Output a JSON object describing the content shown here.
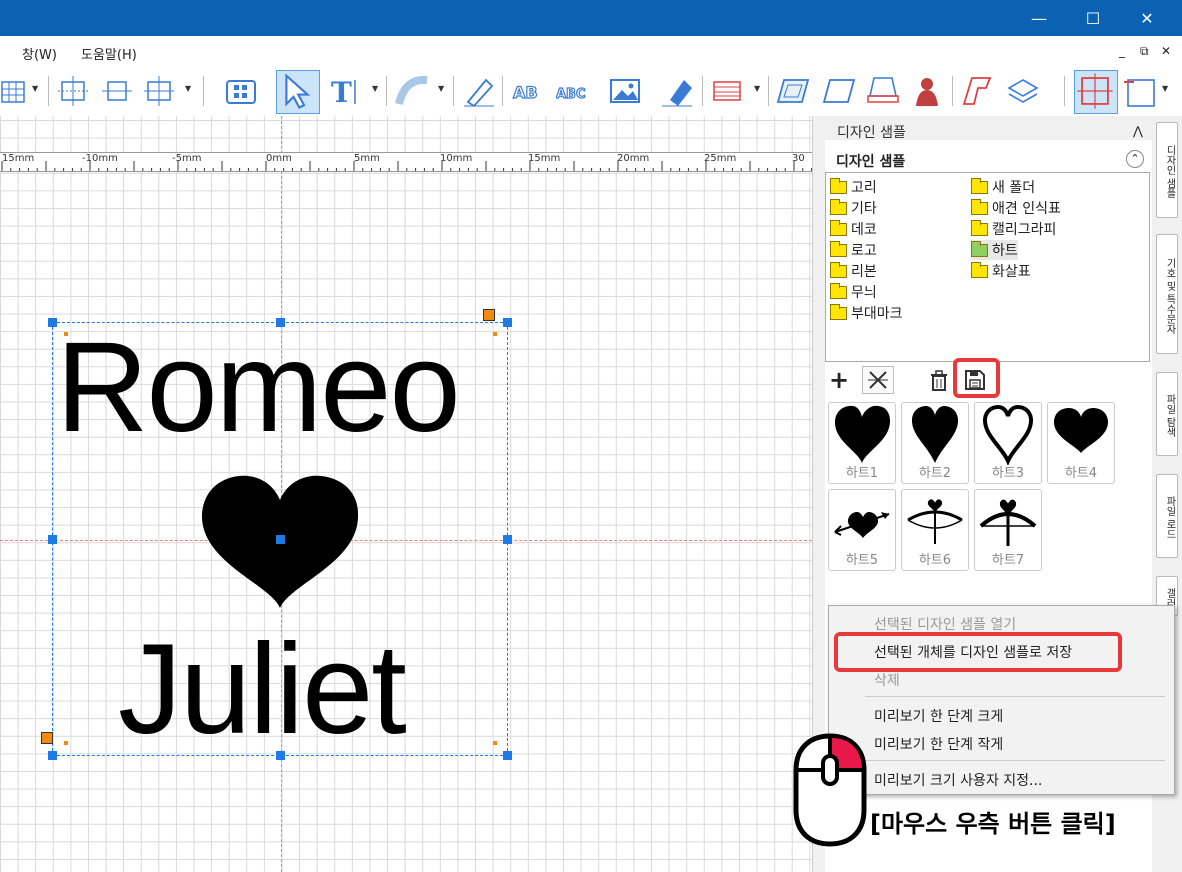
{
  "window": {
    "minimize_icon": "minimize-icon",
    "maximize_icon": "maximize-icon",
    "close_icon": "close-icon"
  },
  "menu": {
    "window": "창(W)",
    "help": "도움말(H)"
  },
  "ruler": {
    "labels": [
      "15mm",
      "-10mm",
      "-5mm",
      "0mm",
      "5mm",
      "10mm",
      "15mm",
      "20mm",
      "25mm",
      "30"
    ]
  },
  "canvas": {
    "line1": "Romeo",
    "line2": "Juliet"
  },
  "panel": {
    "header": "디자인 샘플",
    "section_title": "디자인 샘플",
    "folders_left": [
      "고리",
      "기타",
      "데코",
      "로고",
      "리본",
      "무늬",
      "부대마크"
    ],
    "folders_right": [
      "새 폴더",
      "애견 인식표",
      "캘리그라피",
      "하트",
      "화살표"
    ],
    "samples": [
      "하트1",
      "하트2",
      "하트3",
      "하트4",
      "하트5",
      "하트6",
      "하트7"
    ]
  },
  "vtabs": [
    "디자인 샘플",
    "기호 및 특수문자",
    "파일 탐색",
    "파일 로드",
    "갤러"
  ],
  "context_menu": {
    "items": [
      "선택된 디자인 샘플 열기",
      "선택된 개체를 디자인 샘플로 저장",
      "삭제",
      "미리보기 한 단계 크게",
      "미리보기 한 단계 작게",
      "미리보기 크기 사용자 지정..."
    ]
  },
  "annotation": "[마우스 우측 버튼 클릭]",
  "colors": {
    "titlebar": "#0b62b5",
    "highlight": "#e8393a",
    "handle": "#1e7be6",
    "mouse_button": "#e8194a"
  }
}
